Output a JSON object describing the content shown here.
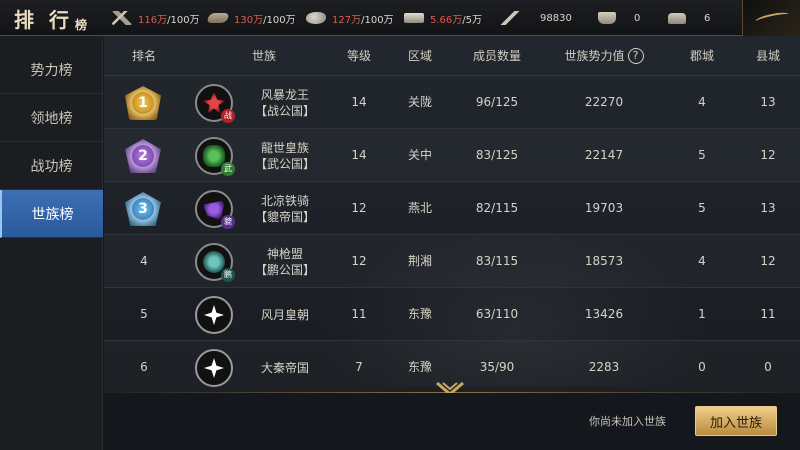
{
  "header": {
    "title_main": "排 行",
    "title_sub": "榜",
    "resources": [
      {
        "icon": "grain-icon",
        "current": "116万",
        "max": "/100万"
      },
      {
        "icon": "wood-icon",
        "current": "130万",
        "max": "/100万"
      },
      {
        "icon": "stone-icon",
        "current": "127万",
        "max": "/100万"
      },
      {
        "icon": "iron-icon",
        "current": "5.66万",
        "max": "/5万"
      },
      {
        "icon": "troops-icon",
        "value": "98830"
      },
      {
        "icon": "gold-icon",
        "value": "0"
      },
      {
        "icon": "ingot-icon",
        "value": "6"
      }
    ]
  },
  "sidebar": {
    "items": [
      {
        "label": "势力榜"
      },
      {
        "label": "领地榜"
      },
      {
        "label": "战功榜"
      },
      {
        "label": "世族榜"
      }
    ],
    "active_index": 3
  },
  "table": {
    "headers": {
      "rank": "排名",
      "clan": "世族",
      "level": "等级",
      "region": "区域",
      "members": "成员数量",
      "power": "世族势力值",
      "power_help": "?",
      "commandery": "郡城",
      "county": "县城"
    },
    "rows": [
      {
        "rank": "1",
        "emblem_badge": "战",
        "name_line1": "风暴龙王",
        "name_line2": "【战公国】",
        "level": "14",
        "region": "关陇",
        "members": "96/125",
        "power": "22270",
        "commandery": "4",
        "county": "13"
      },
      {
        "rank": "2",
        "emblem_badge": "武",
        "name_line1": "龍世皇族",
        "name_line2": "【武公国】",
        "level": "14",
        "region": "关中",
        "members": "83/125",
        "power": "22147",
        "commandery": "5",
        "county": "12"
      },
      {
        "rank": "3",
        "emblem_badge": "貔",
        "name_line1": "北凉铁骑",
        "name_line2": "【貔帝国】",
        "level": "12",
        "region": "燕北",
        "members": "82/115",
        "power": "19703",
        "commandery": "5",
        "county": "13"
      },
      {
        "rank": "4",
        "emblem_badge": "鹏",
        "name_line1": "神枪盟",
        "name_line2": "【鹏公国】",
        "level": "12",
        "region": "荆湘",
        "members": "83/115",
        "power": "18573",
        "commandery": "4",
        "county": "12"
      },
      {
        "rank": "5",
        "emblem_badge": "",
        "name_line1": "风月皇朝",
        "name_line2": "",
        "level": "11",
        "region": "东豫",
        "members": "63/110",
        "power": "13426",
        "commandery": "1",
        "county": "11"
      },
      {
        "rank": "6",
        "emblem_badge": "",
        "name_line1": "大秦帝国",
        "name_line2": "",
        "level": "7",
        "region": "东豫",
        "members": "35/90",
        "power": "2283",
        "commandery": "0",
        "county": "0"
      }
    ]
  },
  "footer": {
    "status_text": "你尚未加入世族",
    "join_label": "加入世族"
  }
}
